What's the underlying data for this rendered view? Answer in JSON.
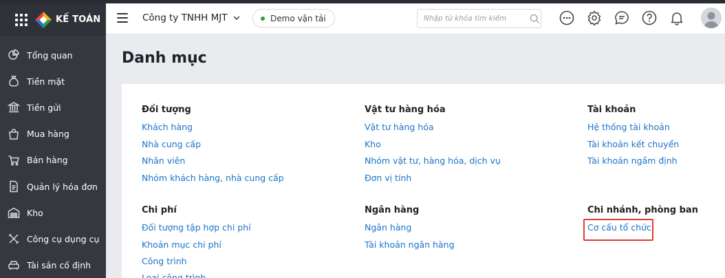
{
  "app": {
    "brand": "KẾ TOÁN"
  },
  "sidebar": {
    "items": [
      {
        "label": "Tổng quan",
        "icon": "pie-chart-icon"
      },
      {
        "label": "Tiền mặt",
        "icon": "money-bag-icon"
      },
      {
        "label": "Tiền gửi",
        "icon": "bank-icon"
      },
      {
        "label": "Mua hàng",
        "icon": "shopping-bag-icon"
      },
      {
        "label": "Bán hàng",
        "icon": "cart-icon"
      },
      {
        "label": "Quản lý hóa đơn",
        "icon": "invoice-icon"
      },
      {
        "label": "Kho",
        "icon": "warehouse-icon"
      },
      {
        "label": "Công cụ dụng cụ",
        "icon": "tools-icon"
      },
      {
        "label": "Tài sản cố định",
        "icon": "car-icon"
      }
    ]
  },
  "header": {
    "company": "Công ty TNHH MJT",
    "demo_label": "Demo vận tải",
    "search_placeholder": "Nhập từ khóa tìm kiếm"
  },
  "colors": {
    "accent_green": "#2e9e4a",
    "link_blue": "#1a73c9",
    "highlight_red": "#e53935"
  },
  "main": {
    "title": "Danh mục",
    "groups": [
      {
        "title": "Đối tượng",
        "links": [
          "Khách hàng",
          "Nhà cung cấp",
          "Nhân viên",
          "Nhóm khách hàng, nhà cung cấp"
        ]
      },
      {
        "title": "Vật tư hàng hóa",
        "links": [
          "Vật tư hàng hóa",
          "Kho",
          "Nhóm vật tư, hàng hóa, dịch vụ",
          "Đơn vị tính"
        ]
      },
      {
        "title": "Tài khoản",
        "links": [
          "Hệ thống tài khoản",
          "Tài khoản kết chuyển",
          "Tài khoản ngầm định"
        ]
      },
      {
        "title": "Chi phí",
        "links": [
          "Đối tượng tập hợp chi phí",
          "Khoản mục chi phí",
          "Công trình",
          "Loại công trình"
        ]
      },
      {
        "title": "Ngân hàng",
        "links": [
          "Ngân hàng",
          "Tài khoản ngân hàng"
        ]
      },
      {
        "title": "Chi nhánh, phòng ban",
        "links": [
          "Cơ cấu tổ chức"
        ]
      }
    ]
  }
}
